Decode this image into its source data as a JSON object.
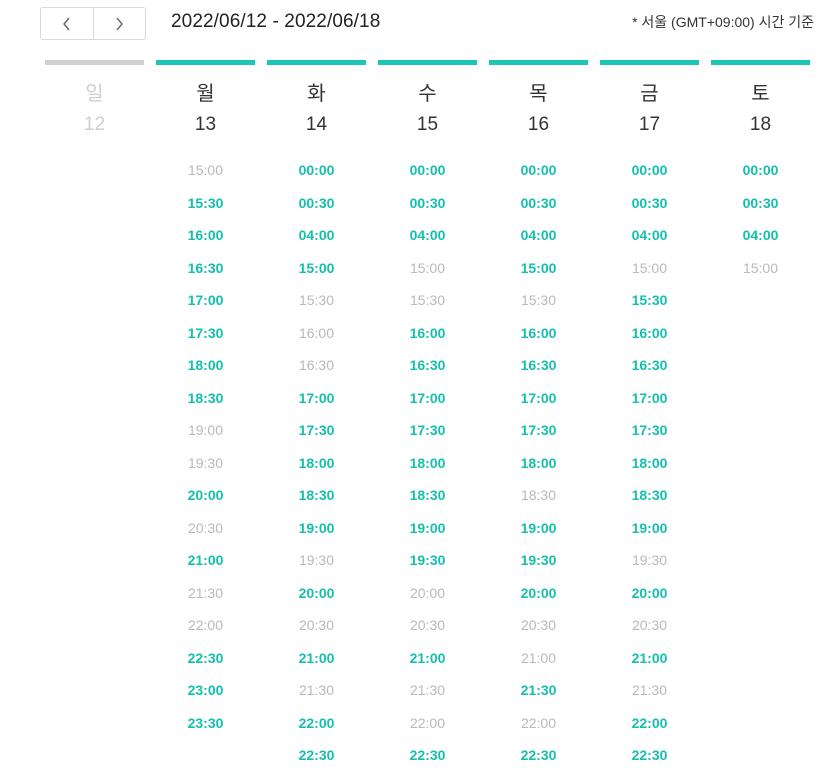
{
  "nav": {
    "prev_icon": "chevron-left-icon",
    "next_icon": "chevron-right-icon"
  },
  "header": {
    "date_range": "2022/06/12 - 2022/06/18",
    "timezone_note": "* 서울 (GMT+09:00) 시간 기준"
  },
  "colors": {
    "accent": "#14bfad",
    "unavailable": "#b9b9b9",
    "inactive_bar": "#d0d0d0"
  },
  "days": [
    {
      "name": "일",
      "date": "12",
      "active": false,
      "slots": []
    },
    {
      "name": "월",
      "date": "13",
      "active": true,
      "slots": [
        {
          "time": "15:00",
          "available": false
        },
        {
          "time": "15:30",
          "available": true
        },
        {
          "time": "16:00",
          "available": true
        },
        {
          "time": "16:30",
          "available": true
        },
        {
          "time": "17:00",
          "available": true
        },
        {
          "time": "17:30",
          "available": true
        },
        {
          "time": "18:00",
          "available": true
        },
        {
          "time": "18:30",
          "available": true
        },
        {
          "time": "19:00",
          "available": false
        },
        {
          "time": "19:30",
          "available": false
        },
        {
          "time": "20:00",
          "available": true
        },
        {
          "time": "20:30",
          "available": false
        },
        {
          "time": "21:00",
          "available": true
        },
        {
          "time": "21:30",
          "available": false
        },
        {
          "time": "22:00",
          "available": false
        },
        {
          "time": "22:30",
          "available": true
        },
        {
          "time": "23:00",
          "available": true
        },
        {
          "time": "23:30",
          "available": true
        }
      ]
    },
    {
      "name": "화",
      "date": "14",
      "active": true,
      "slots": [
        {
          "time": "00:00",
          "available": true
        },
        {
          "time": "00:30",
          "available": true
        },
        {
          "time": "04:00",
          "available": true
        },
        {
          "time": "15:00",
          "available": true
        },
        {
          "time": "15:30",
          "available": false
        },
        {
          "time": "16:00",
          "available": false
        },
        {
          "time": "16:30",
          "available": false
        },
        {
          "time": "17:00",
          "available": true
        },
        {
          "time": "17:30",
          "available": true
        },
        {
          "time": "18:00",
          "available": true
        },
        {
          "time": "18:30",
          "available": true
        },
        {
          "time": "19:00",
          "available": true
        },
        {
          "time": "19:30",
          "available": false
        },
        {
          "time": "20:00",
          "available": true
        },
        {
          "time": "20:30",
          "available": false
        },
        {
          "time": "21:00",
          "available": true
        },
        {
          "time": "21:30",
          "available": false
        },
        {
          "time": "22:00",
          "available": true
        },
        {
          "time": "22:30",
          "available": true
        }
      ]
    },
    {
      "name": "수",
      "date": "15",
      "active": true,
      "slots": [
        {
          "time": "00:00",
          "available": true
        },
        {
          "time": "00:30",
          "available": true
        },
        {
          "time": "04:00",
          "available": true
        },
        {
          "time": "15:00",
          "available": false
        },
        {
          "time": "15:30",
          "available": false
        },
        {
          "time": "16:00",
          "available": true
        },
        {
          "time": "16:30",
          "available": true
        },
        {
          "time": "17:00",
          "available": true
        },
        {
          "time": "17:30",
          "available": true
        },
        {
          "time": "18:00",
          "available": true
        },
        {
          "time": "18:30",
          "available": true
        },
        {
          "time": "19:00",
          "available": true
        },
        {
          "time": "19:30",
          "available": true
        },
        {
          "time": "20:00",
          "available": false
        },
        {
          "time": "20:30",
          "available": false
        },
        {
          "time": "21:00",
          "available": true
        },
        {
          "time": "21:30",
          "available": false
        },
        {
          "time": "22:00",
          "available": false
        },
        {
          "time": "22:30",
          "available": true
        }
      ]
    },
    {
      "name": "목",
      "date": "16",
      "active": true,
      "slots": [
        {
          "time": "00:00",
          "available": true
        },
        {
          "time": "00:30",
          "available": true
        },
        {
          "time": "04:00",
          "available": true
        },
        {
          "time": "15:00",
          "available": true
        },
        {
          "time": "15:30",
          "available": false
        },
        {
          "time": "16:00",
          "available": true
        },
        {
          "time": "16:30",
          "available": true
        },
        {
          "time": "17:00",
          "available": true
        },
        {
          "time": "17:30",
          "available": true
        },
        {
          "time": "18:00",
          "available": true
        },
        {
          "time": "18:30",
          "available": false
        },
        {
          "time": "19:00",
          "available": true
        },
        {
          "time": "19:30",
          "available": true
        },
        {
          "time": "20:00",
          "available": true
        },
        {
          "time": "20:30",
          "available": false
        },
        {
          "time": "21:00",
          "available": false
        },
        {
          "time": "21:30",
          "available": true
        },
        {
          "time": "22:00",
          "available": false
        },
        {
          "time": "22:30",
          "available": true
        }
      ]
    },
    {
      "name": "금",
      "date": "17",
      "active": true,
      "slots": [
        {
          "time": "00:00",
          "available": true
        },
        {
          "time": "00:30",
          "available": true
        },
        {
          "time": "04:00",
          "available": true
        },
        {
          "time": "15:00",
          "available": false
        },
        {
          "time": "15:30",
          "available": true
        },
        {
          "time": "16:00",
          "available": true
        },
        {
          "time": "16:30",
          "available": true
        },
        {
          "time": "17:00",
          "available": true
        },
        {
          "time": "17:30",
          "available": true
        },
        {
          "time": "18:00",
          "available": true
        },
        {
          "time": "18:30",
          "available": true
        },
        {
          "time": "19:00",
          "available": true
        },
        {
          "time": "19:30",
          "available": false
        },
        {
          "time": "20:00",
          "available": true
        },
        {
          "time": "20:30",
          "available": false
        },
        {
          "time": "21:00",
          "available": true
        },
        {
          "time": "21:30",
          "available": false
        },
        {
          "time": "22:00",
          "available": true
        },
        {
          "time": "22:30",
          "available": true
        }
      ]
    },
    {
      "name": "토",
      "date": "18",
      "active": true,
      "slots": [
        {
          "time": "00:00",
          "available": true
        },
        {
          "time": "00:30",
          "available": true
        },
        {
          "time": "04:00",
          "available": true
        },
        {
          "time": "15:00",
          "available": false
        }
      ]
    }
  ]
}
